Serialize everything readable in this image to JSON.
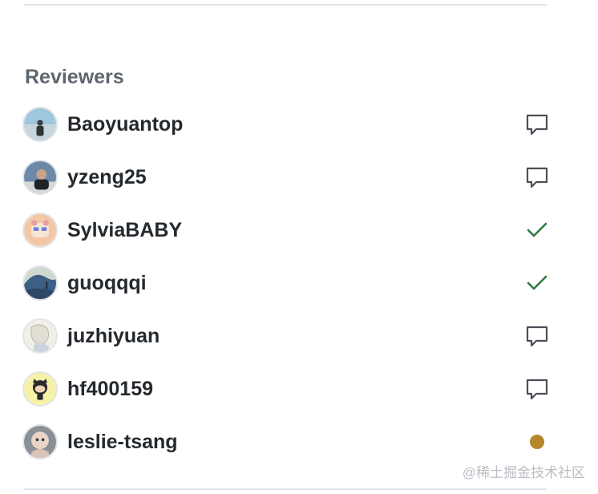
{
  "section": {
    "heading": "Reviewers"
  },
  "reviewers": [
    {
      "login": "Baoyuantop",
      "status": "commented",
      "status_icon": "comment-icon"
    },
    {
      "login": "yzeng25",
      "status": "commented",
      "status_icon": "comment-icon"
    },
    {
      "login": "SylviaBABY",
      "status": "approved",
      "status_icon": "check-icon"
    },
    {
      "login": "guoqqqi",
      "status": "approved",
      "status_icon": "check-icon"
    },
    {
      "login": "juzhiyuan",
      "status": "commented",
      "status_icon": "comment-icon"
    },
    {
      "login": "hf400159",
      "status": "commented",
      "status_icon": "comment-icon"
    },
    {
      "login": "leslie-tsang",
      "status": "pending",
      "status_icon": "pending-dot-icon"
    }
  ],
  "colors": {
    "approved": "#2f7a3e",
    "pending": "#b7872c",
    "comment": "#4a4f57",
    "heading": "#5e6670",
    "text": "#24292e",
    "divider": "#e1e4e8"
  },
  "watermark": "@稀土掘金技术社区"
}
